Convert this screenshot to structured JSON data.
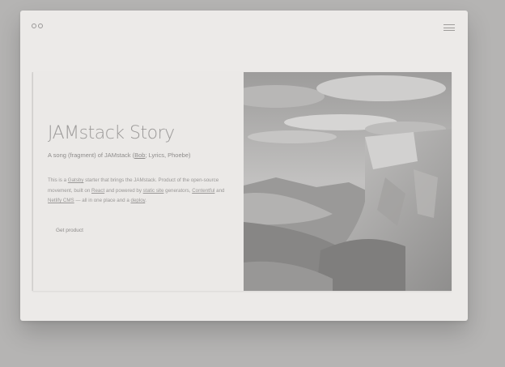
{
  "app": {
    "menu_icon": "hamburger-menu-icon",
    "logo_icon": "infinity-logo-icon"
  },
  "card": {
    "title": "JAMstack Story",
    "subtitle": {
      "before": "A song (fragment) of JAMstack (",
      "link": "Bob",
      "after": "; Lyrics, Phoebe)"
    },
    "description": {
      "p1": "This is a ",
      "l1": "Gatsby",
      "p2": " starter that brings the JAMstack. Product of the open-source movement, built on ",
      "l2": "React",
      "p3": " and powered by ",
      "l3": "static site",
      "p4": " generators, ",
      "l4": "Contentful",
      "p5": " and ",
      "l5": "Netlify CMS",
      "p6": " — all in one place and a ",
      "l6": "deploy",
      "p7": "."
    },
    "button_label": "Get product"
  },
  "colors": {
    "background": "#b5b4b3",
    "window": "#eceae8",
    "card": "#ebe9e7",
    "title": "#9c9a99"
  }
}
